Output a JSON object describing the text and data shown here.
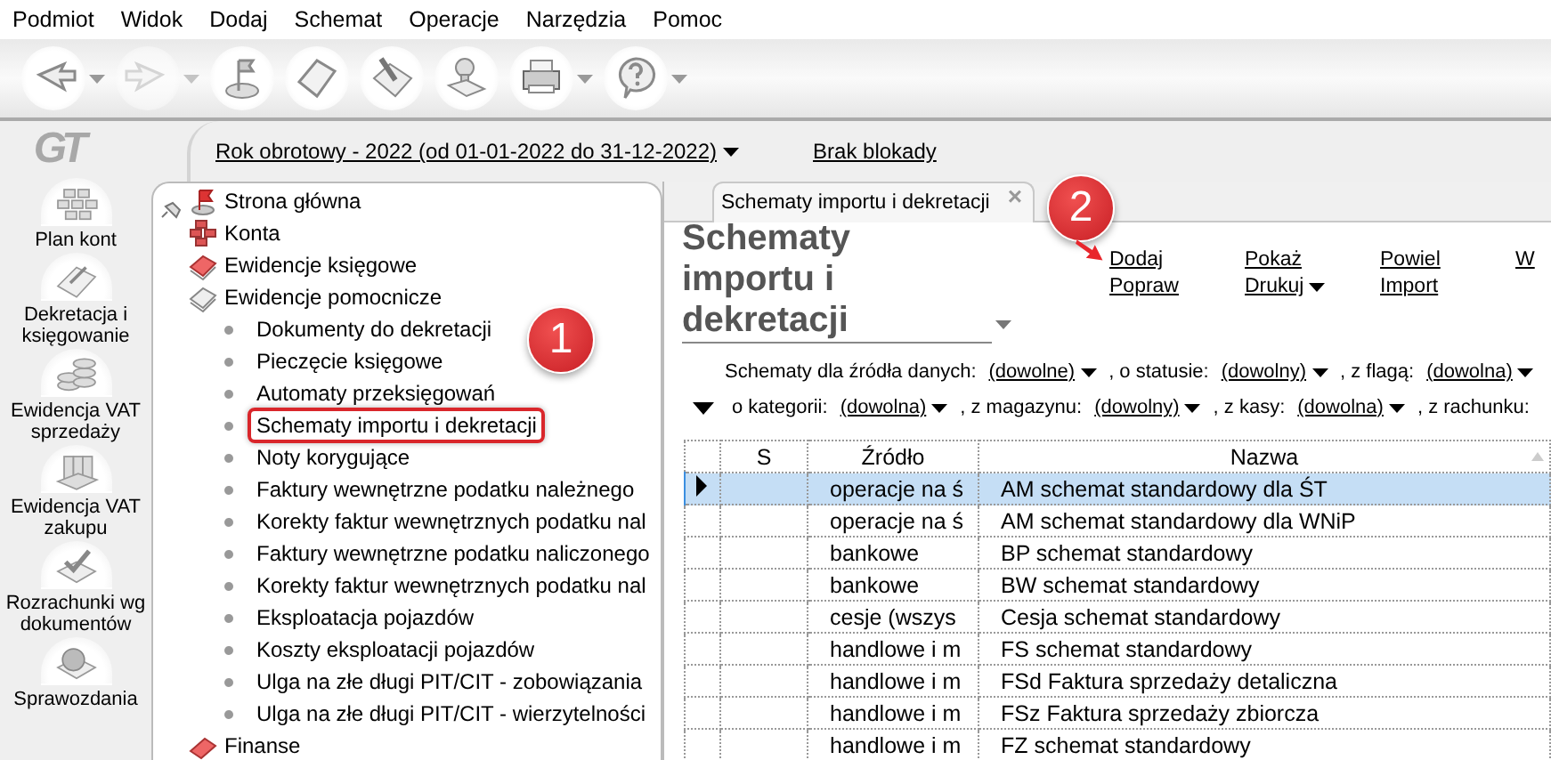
{
  "menu": [
    "Podmiot",
    "Widok",
    "Dodaj",
    "Schemat",
    "Operacje",
    "Narzędzia",
    "Pomoc"
  ],
  "toolbar": [
    {
      "kind": "back",
      "dropdown": true,
      "disabled": false
    },
    {
      "kind": "forward",
      "dropdown": true,
      "disabled": true
    },
    {
      "kind": "flag",
      "dropdown": false,
      "disabled": false
    },
    {
      "kind": "eraser",
      "dropdown": false,
      "disabled": false
    },
    {
      "kind": "brush",
      "dropdown": false,
      "disabled": false
    },
    {
      "kind": "stamp",
      "dropdown": false,
      "disabled": false
    },
    {
      "kind": "printer",
      "dropdown": true,
      "disabled": false
    },
    {
      "kind": "help",
      "dropdown": true,
      "disabled": false
    }
  ],
  "logo": "GT",
  "nav": [
    {
      "kind": "grid",
      "label": "Plan kont"
    },
    {
      "kind": "pencil",
      "label": "Dekretacja i księgowanie"
    },
    {
      "kind": "coins",
      "label": "Ewidencja VAT sprzedaży"
    },
    {
      "kind": "binders",
      "label": "Ewidencja VAT zakupu"
    },
    {
      "kind": "check",
      "label": "Rozrachunki wg dokumentów"
    },
    {
      "kind": "chart",
      "label": "Sprawozdania"
    }
  ],
  "period": "Rok obrotowy - 2022  (od 01-01-2022 do 31-12-2022)",
  "lock": "Brak blokady",
  "tree": [
    {
      "label": "Strona główna",
      "kind": "flag"
    },
    {
      "label": "Konta",
      "kind": "accounts"
    },
    {
      "label": "Ewidencje księgowe",
      "kind": "book"
    },
    {
      "label": "Ewidencje pomocnicze",
      "kind": "book-plain",
      "children": [
        {
          "label": "Dokumenty do dekretacji",
          "selected": false
        },
        {
          "label": "Pieczęcie księgowe",
          "selected": false
        },
        {
          "label": "Automaty przeksięgowań",
          "selected": false
        },
        {
          "label": "Schematy importu i dekretacji",
          "selected": true
        },
        {
          "label": "Noty korygujące",
          "selected": false
        },
        {
          "label": "Faktury wewnętrzne podatku należnego",
          "selected": false
        },
        {
          "label": "Korekty faktur wewnętrznych podatku nal",
          "selected": false
        },
        {
          "label": "Faktury wewnętrzne podatku naliczonego",
          "selected": false
        },
        {
          "label": "Korekty faktur wewnętrznych podatku nal",
          "selected": false
        },
        {
          "label": "Eksploatacja pojazdów",
          "selected": false
        },
        {
          "label": "Koszty eksploatacji pojazdów",
          "selected": false
        },
        {
          "label": "Ulga na złe długi PIT/CIT - zobowiązania",
          "selected": false
        },
        {
          "label": "Ulga na złe długi PIT/CIT - wierzytelności",
          "selected": false
        }
      ]
    },
    {
      "label": "Finanse",
      "kind": "eraser"
    }
  ],
  "tab": {
    "label": "Schematy importu i dekretacji",
    "close": "×"
  },
  "title": "Schematy importu i dekretacji",
  "actions": [
    [
      {
        "label": "Dodaj",
        "dropdown": false
      },
      {
        "label": "Popraw",
        "dropdown": false
      }
    ],
    [
      {
        "label": "Pokaż",
        "dropdown": false
      },
      {
        "label": "Drukuj",
        "dropdown": true
      }
    ],
    [
      {
        "label": "Powiel",
        "dropdown": false
      },
      {
        "label": "Import",
        "dropdown": false
      }
    ],
    [
      {
        "label": "W",
        "dropdown": false
      }
    ]
  ],
  "filters": [
    [
      {
        "label": "Schematy dla źródła danych:",
        "value": "(dowolne)"
      },
      {
        "label": ", o statusie:",
        "value": "(dowolny)"
      },
      {
        "label": ", z flagą:",
        "value": "(dowolna)"
      }
    ],
    [
      {
        "label": "o kategorii:",
        "value": "(dowolna)"
      },
      {
        "label": ", z magazynu:",
        "value": "(dowolny)"
      },
      {
        "label": ", z kasy:",
        "value": "(dowolna)"
      },
      {
        "label": ", z rachunku:"
      }
    ]
  ],
  "table": {
    "columns": [
      "S",
      "Źródło",
      "Nazwa"
    ],
    "rows": [
      {
        "source": "operacje na ś",
        "name": "AM schemat standardowy dla ŚT",
        "selected": true
      },
      {
        "source": "operacje na ś",
        "name": "AM schemat standardowy dla WNiP",
        "selected": false
      },
      {
        "source": "bankowe",
        "name": "BP schemat standardowy",
        "selected": false
      },
      {
        "source": "bankowe",
        "name": "BW schemat standardowy",
        "selected": false
      },
      {
        "source": "cesje (wszys",
        "name": "Cesja schemat standardowy",
        "selected": false
      },
      {
        "source": "handlowe i m",
        "name": "FS schemat standardowy",
        "selected": false
      },
      {
        "source": "handlowe i m",
        "name": "FSd Faktura sprzedaży detaliczna",
        "selected": false
      },
      {
        "source": "handlowe i m",
        "name": "FSz Faktura sprzedaży zbiorcza",
        "selected": false
      },
      {
        "source": "handlowe i m",
        "name": "FZ schemat standardowy",
        "selected": false
      }
    ]
  },
  "annotations": [
    "1",
    "2"
  ]
}
